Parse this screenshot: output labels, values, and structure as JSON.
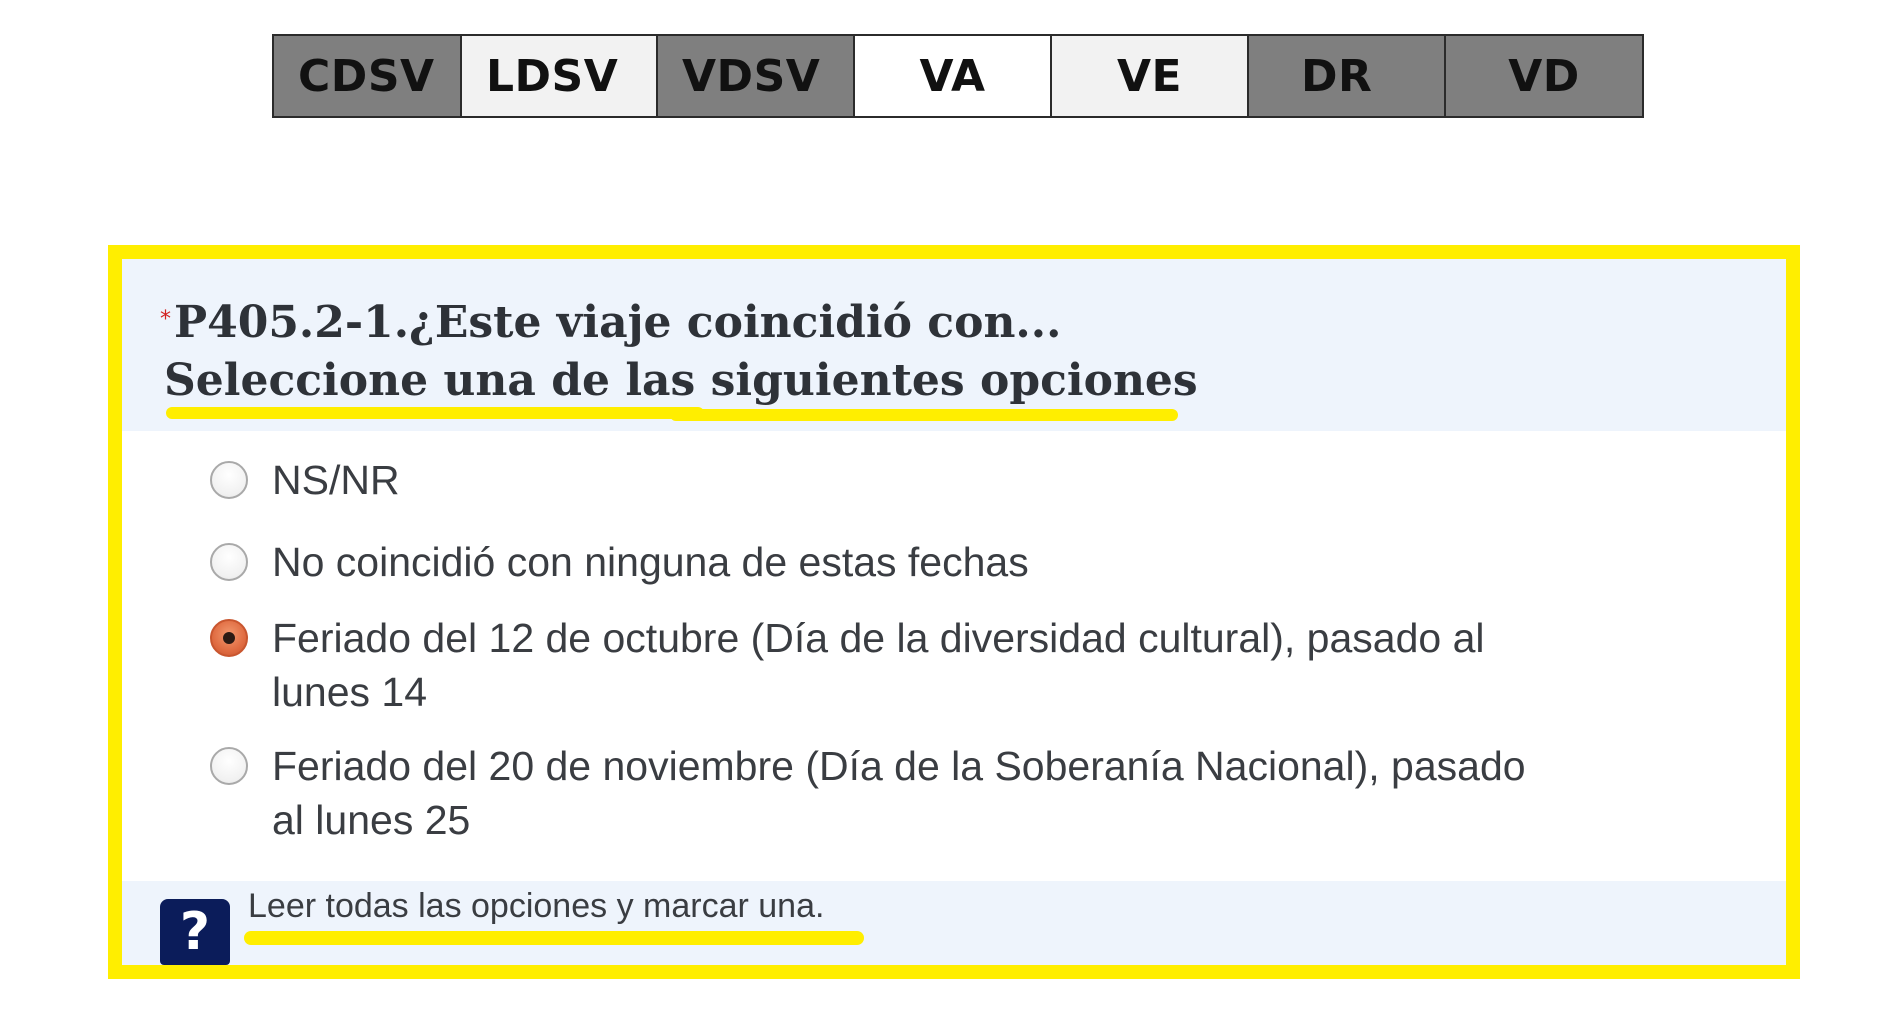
{
  "code_tabs": [
    {
      "label": "CDSV",
      "state": "dark"
    },
    {
      "label": "LDSV",
      "state": "light"
    },
    {
      "label": "VDSV",
      "state": "dark"
    },
    {
      "label": "VA",
      "state": "white"
    },
    {
      "label": "VE",
      "state": "light"
    },
    {
      "label": "DR",
      "state": "dark"
    },
    {
      "label": "VD",
      "state": "dark"
    }
  ],
  "question": {
    "required_marker": "*",
    "title": "P405.2-1.¿Este viaje coincidió con...",
    "subtitle": "Seleccione una de las siguientes opciones"
  },
  "options": [
    {
      "label": "NS/NR",
      "selected": false
    },
    {
      "label": "No coincidió con ninguna de estas fechas",
      "selected": false
    },
    {
      "label": "Feriado del 12 de octubre (Día de la diversidad cultural), pasado al lunes 14",
      "selected": true
    },
    {
      "label": "Feriado del 20 de noviembre (Día de la Soberanía Nacional), pasado al lunes 25",
      "selected": false
    }
  ],
  "help": {
    "icon_glyph": "?",
    "text": "Leer todas las opciones y marcar una."
  },
  "colors": {
    "highlight": "#ffee00",
    "tab_dark": "#7f7f7f",
    "tab_light": "#f2f2f2",
    "radio_selected": "#e06c42",
    "help_icon_bg": "#0b1c5a"
  }
}
